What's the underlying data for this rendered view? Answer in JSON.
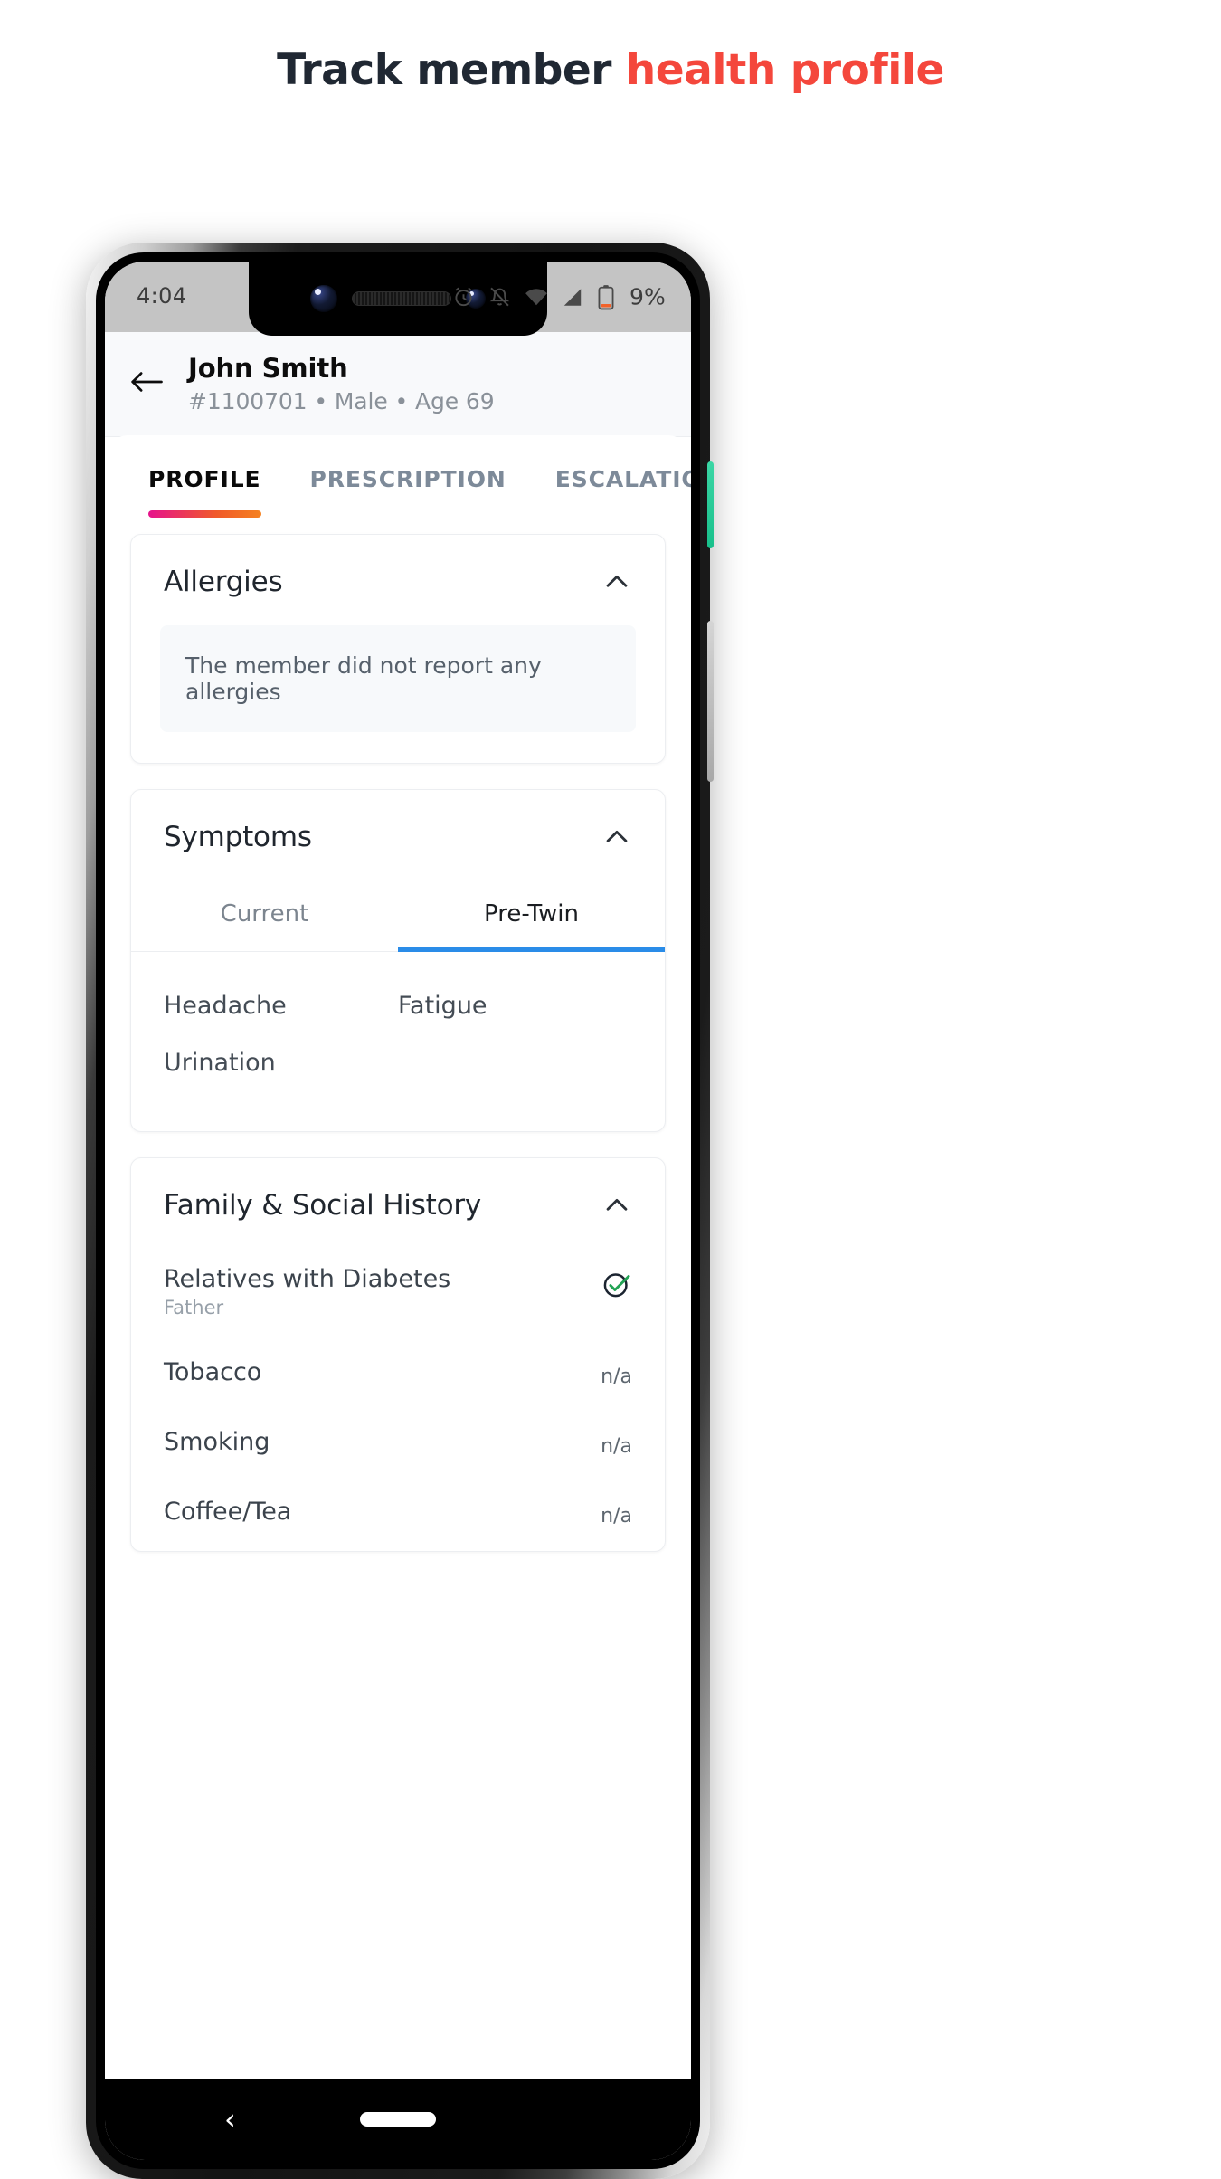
{
  "headline": {
    "text_primary": "Track member ",
    "text_accent": "health profile",
    "accent_color": "#f4473c",
    "primary_color": "#202833"
  },
  "status_bar": {
    "time": "4:04",
    "battery_percent": "9%",
    "icons": [
      "alarm-icon",
      "notifications-off-icon",
      "wifi-icon",
      "cellular-signal-icon",
      "battery-low-icon"
    ]
  },
  "header": {
    "back_icon": "back-arrow-icon",
    "name": "John Smith",
    "subtitle": "#1100701 • Male • Age 69"
  },
  "tabs": [
    {
      "label": "PROFILE",
      "active": true
    },
    {
      "label": "PRESCRIPTION",
      "active": false
    },
    {
      "label": "ESCALATIONS",
      "active": false
    }
  ],
  "tab_indicator": {
    "gradient_from": "#e6138c",
    "gradient_to": "#f58220"
  },
  "cards": {
    "allergies": {
      "title": "Allergies",
      "chevron": "chevron-up-icon",
      "empty_message": "The member did not report any allergies"
    },
    "symptoms": {
      "title": "Symptoms",
      "chevron": "chevron-up-icon",
      "subtabs": [
        {
          "label": "Current",
          "active": false
        },
        {
          "label": "Pre-Twin",
          "active": true
        }
      ],
      "active_subtab_color": "#2a8ce8",
      "items": [
        "Headache",
        "Fatigue",
        "Urination"
      ]
    },
    "history": {
      "title": "Family & Social History",
      "chevron": "chevron-up-icon",
      "rows": [
        {
          "label": "Relatives with Diabetes",
          "sub": "Father",
          "value": "",
          "icon": "check-circle-icon"
        },
        {
          "label": "Tobacco",
          "sub": "",
          "value": "n/a",
          "icon": ""
        },
        {
          "label": "Smoking",
          "sub": "",
          "value": "n/a",
          "icon": ""
        },
        {
          "label": "Coffee/Tea",
          "sub": "",
          "value": "n/a",
          "icon": ""
        }
      ]
    }
  },
  "navbar": {
    "back_glyph": "‹",
    "home_pill": "home-pill"
  }
}
